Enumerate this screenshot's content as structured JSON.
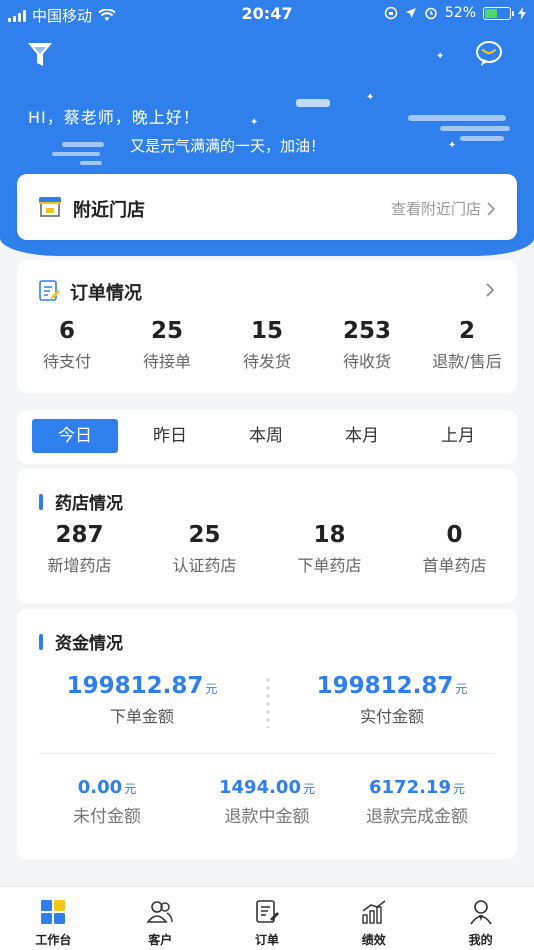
{
  "status_bar": {
    "carrier": "中国移动",
    "time": "20:47",
    "battery": "52%"
  },
  "header": {
    "greeting": "HI，蔡老师，晚上好！",
    "subtitle": "又是元气满满的一天，加油！"
  },
  "nearby": {
    "title": "附近门店",
    "link": "查看附近门店"
  },
  "orders": {
    "title": "订单情况",
    "stats": [
      {
        "value": "6",
        "label": "待支付"
      },
      {
        "value": "25",
        "label": "待接单"
      },
      {
        "value": "15",
        "label": "待发货"
      },
      {
        "value": "253",
        "label": "待收货"
      },
      {
        "value": "2",
        "label": "退款/售后"
      }
    ]
  },
  "period_tabs": [
    "今日",
    "昨日",
    "本周",
    "本月",
    "上月"
  ],
  "pharmacy": {
    "title": "药店情况",
    "stats": [
      {
        "value": "287",
        "label": "新增药店"
      },
      {
        "value": "25",
        "label": "认证药店"
      },
      {
        "value": "18",
        "label": "下单药店"
      },
      {
        "value": "0",
        "label": "首单药店"
      }
    ]
  },
  "funds": {
    "title": "资金情况",
    "unit": "元",
    "primary": [
      {
        "value": "199812.87",
        "label": "下单金额"
      },
      {
        "value": "199812.87",
        "label": "实付金额"
      }
    ],
    "secondary": [
      {
        "value": "0.00",
        "label": "未付金额"
      },
      {
        "value": "1494.00",
        "label": "退款中金额"
      },
      {
        "value": "6172.19",
        "label": "退款完成金额"
      }
    ]
  },
  "tabbar": [
    "工作台",
    "客户",
    "订单",
    "绩效",
    "我的"
  ],
  "colors": {
    "primary": "#2f80ed",
    "background": "#f4f5f7",
    "tab_active": "#2f80ed"
  }
}
